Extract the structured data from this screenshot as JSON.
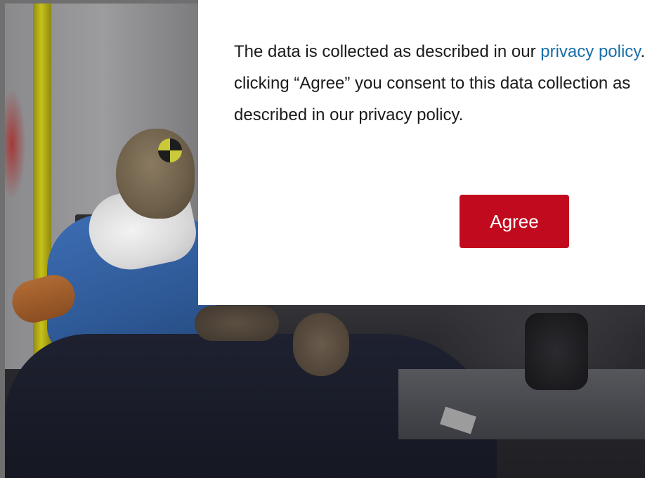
{
  "consent": {
    "text_before_link": "The data is collected as described in our ",
    "link_text": "privacy policy",
    "text_after_link": ". By clicking “Agree” you consent to this data collection as described in our privacy policy.",
    "agree_label": "Agree"
  },
  "colors": {
    "button_bg": "#c20a1f",
    "link": "#1a6fa8",
    "dialog_bg": "#ffffff"
  }
}
